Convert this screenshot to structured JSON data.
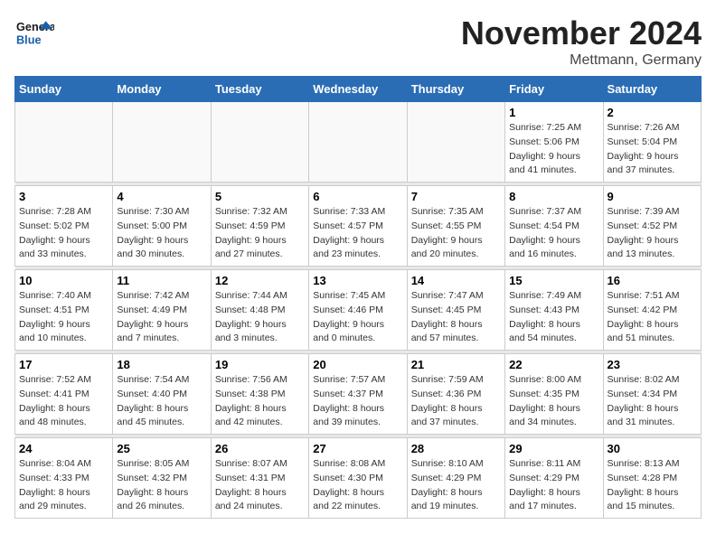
{
  "header": {
    "logo_line1": "General",
    "logo_line2": "Blue",
    "month": "November 2024",
    "location": "Mettmann, Germany"
  },
  "weekdays": [
    "Sunday",
    "Monday",
    "Tuesday",
    "Wednesday",
    "Thursday",
    "Friday",
    "Saturday"
  ],
  "weeks": [
    [
      {
        "day": "",
        "info": []
      },
      {
        "day": "",
        "info": []
      },
      {
        "day": "",
        "info": []
      },
      {
        "day": "",
        "info": []
      },
      {
        "day": "",
        "info": []
      },
      {
        "day": "1",
        "info": [
          "Sunrise: 7:25 AM",
          "Sunset: 5:06 PM",
          "Daylight: 9 hours",
          "and 41 minutes."
        ]
      },
      {
        "day": "2",
        "info": [
          "Sunrise: 7:26 AM",
          "Sunset: 5:04 PM",
          "Daylight: 9 hours",
          "and 37 minutes."
        ]
      }
    ],
    [
      {
        "day": "3",
        "info": [
          "Sunrise: 7:28 AM",
          "Sunset: 5:02 PM",
          "Daylight: 9 hours",
          "and 33 minutes."
        ]
      },
      {
        "day": "4",
        "info": [
          "Sunrise: 7:30 AM",
          "Sunset: 5:00 PM",
          "Daylight: 9 hours",
          "and 30 minutes."
        ]
      },
      {
        "day": "5",
        "info": [
          "Sunrise: 7:32 AM",
          "Sunset: 4:59 PM",
          "Daylight: 9 hours",
          "and 27 minutes."
        ]
      },
      {
        "day": "6",
        "info": [
          "Sunrise: 7:33 AM",
          "Sunset: 4:57 PM",
          "Daylight: 9 hours",
          "and 23 minutes."
        ]
      },
      {
        "day": "7",
        "info": [
          "Sunrise: 7:35 AM",
          "Sunset: 4:55 PM",
          "Daylight: 9 hours",
          "and 20 minutes."
        ]
      },
      {
        "day": "8",
        "info": [
          "Sunrise: 7:37 AM",
          "Sunset: 4:54 PM",
          "Daylight: 9 hours",
          "and 16 minutes."
        ]
      },
      {
        "day": "9",
        "info": [
          "Sunrise: 7:39 AM",
          "Sunset: 4:52 PM",
          "Daylight: 9 hours",
          "and 13 minutes."
        ]
      }
    ],
    [
      {
        "day": "10",
        "info": [
          "Sunrise: 7:40 AM",
          "Sunset: 4:51 PM",
          "Daylight: 9 hours",
          "and 10 minutes."
        ]
      },
      {
        "day": "11",
        "info": [
          "Sunrise: 7:42 AM",
          "Sunset: 4:49 PM",
          "Daylight: 9 hours",
          "and 7 minutes."
        ]
      },
      {
        "day": "12",
        "info": [
          "Sunrise: 7:44 AM",
          "Sunset: 4:48 PM",
          "Daylight: 9 hours",
          "and 3 minutes."
        ]
      },
      {
        "day": "13",
        "info": [
          "Sunrise: 7:45 AM",
          "Sunset: 4:46 PM",
          "Daylight: 9 hours",
          "and 0 minutes."
        ]
      },
      {
        "day": "14",
        "info": [
          "Sunrise: 7:47 AM",
          "Sunset: 4:45 PM",
          "Daylight: 8 hours",
          "and 57 minutes."
        ]
      },
      {
        "day": "15",
        "info": [
          "Sunrise: 7:49 AM",
          "Sunset: 4:43 PM",
          "Daylight: 8 hours",
          "and 54 minutes."
        ]
      },
      {
        "day": "16",
        "info": [
          "Sunrise: 7:51 AM",
          "Sunset: 4:42 PM",
          "Daylight: 8 hours",
          "and 51 minutes."
        ]
      }
    ],
    [
      {
        "day": "17",
        "info": [
          "Sunrise: 7:52 AM",
          "Sunset: 4:41 PM",
          "Daylight: 8 hours",
          "and 48 minutes."
        ]
      },
      {
        "day": "18",
        "info": [
          "Sunrise: 7:54 AM",
          "Sunset: 4:40 PM",
          "Daylight: 8 hours",
          "and 45 minutes."
        ]
      },
      {
        "day": "19",
        "info": [
          "Sunrise: 7:56 AM",
          "Sunset: 4:38 PM",
          "Daylight: 8 hours",
          "and 42 minutes."
        ]
      },
      {
        "day": "20",
        "info": [
          "Sunrise: 7:57 AM",
          "Sunset: 4:37 PM",
          "Daylight: 8 hours",
          "and 39 minutes."
        ]
      },
      {
        "day": "21",
        "info": [
          "Sunrise: 7:59 AM",
          "Sunset: 4:36 PM",
          "Daylight: 8 hours",
          "and 37 minutes."
        ]
      },
      {
        "day": "22",
        "info": [
          "Sunrise: 8:00 AM",
          "Sunset: 4:35 PM",
          "Daylight: 8 hours",
          "and 34 minutes."
        ]
      },
      {
        "day": "23",
        "info": [
          "Sunrise: 8:02 AM",
          "Sunset: 4:34 PM",
          "Daylight: 8 hours",
          "and 31 minutes."
        ]
      }
    ],
    [
      {
        "day": "24",
        "info": [
          "Sunrise: 8:04 AM",
          "Sunset: 4:33 PM",
          "Daylight: 8 hours",
          "and 29 minutes."
        ]
      },
      {
        "day": "25",
        "info": [
          "Sunrise: 8:05 AM",
          "Sunset: 4:32 PM",
          "Daylight: 8 hours",
          "and 26 minutes."
        ]
      },
      {
        "day": "26",
        "info": [
          "Sunrise: 8:07 AM",
          "Sunset: 4:31 PM",
          "Daylight: 8 hours",
          "and 24 minutes."
        ]
      },
      {
        "day": "27",
        "info": [
          "Sunrise: 8:08 AM",
          "Sunset: 4:30 PM",
          "Daylight: 8 hours",
          "and 22 minutes."
        ]
      },
      {
        "day": "28",
        "info": [
          "Sunrise: 8:10 AM",
          "Sunset: 4:29 PM",
          "Daylight: 8 hours",
          "and 19 minutes."
        ]
      },
      {
        "day": "29",
        "info": [
          "Sunrise: 8:11 AM",
          "Sunset: 4:29 PM",
          "Daylight: 8 hours",
          "and 17 minutes."
        ]
      },
      {
        "day": "30",
        "info": [
          "Sunrise: 8:13 AM",
          "Sunset: 4:28 PM",
          "Daylight: 8 hours",
          "and 15 minutes."
        ]
      }
    ]
  ]
}
